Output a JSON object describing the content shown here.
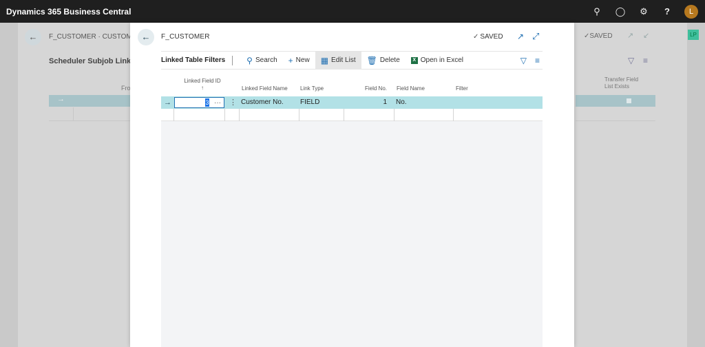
{
  "app": {
    "title": "Dynamics 365 Business Central",
    "avatar": "L"
  },
  "topbar_icons": [
    "search-icon",
    "bell-icon",
    "gear-icon",
    "help-icon"
  ],
  "background_page": {
    "breadcrumb": "F_CUSTOMER · CUSTOMER",
    "subtitle": "Scheduler Subjob Linked Tal",
    "col_from": "Fro",
    "saved": "SAVED",
    "right_header": "Transfer Field\nList Exists",
    "lp_badge": "LP"
  },
  "dialog": {
    "title": "F_CUSTOMER",
    "saved": "SAVED",
    "list_title": "Linked Table Filters",
    "actions": {
      "search": "Search",
      "new": "New",
      "edit_list": "Edit List",
      "delete": "Delete",
      "open_excel": "Open in Excel"
    },
    "columns": {
      "linked_field_id": "Linked Field ID",
      "sort_arrow": "↑",
      "linked_field_name": "Linked Field Name",
      "link_type": "Link Type",
      "field_no": "Field No.",
      "field_name": "Field Name",
      "filter": "Filter"
    },
    "rows": [
      {
        "linked_field_id": "3",
        "linked_field_name": "Customer No.",
        "link_type": "FIELD",
        "field_no": "1",
        "field_name": "No.",
        "filter": ""
      }
    ]
  },
  "colors": {
    "accent": "#1f6fb2",
    "selected_row": "#b2e1e6",
    "appbar": "#1f1f1f"
  }
}
